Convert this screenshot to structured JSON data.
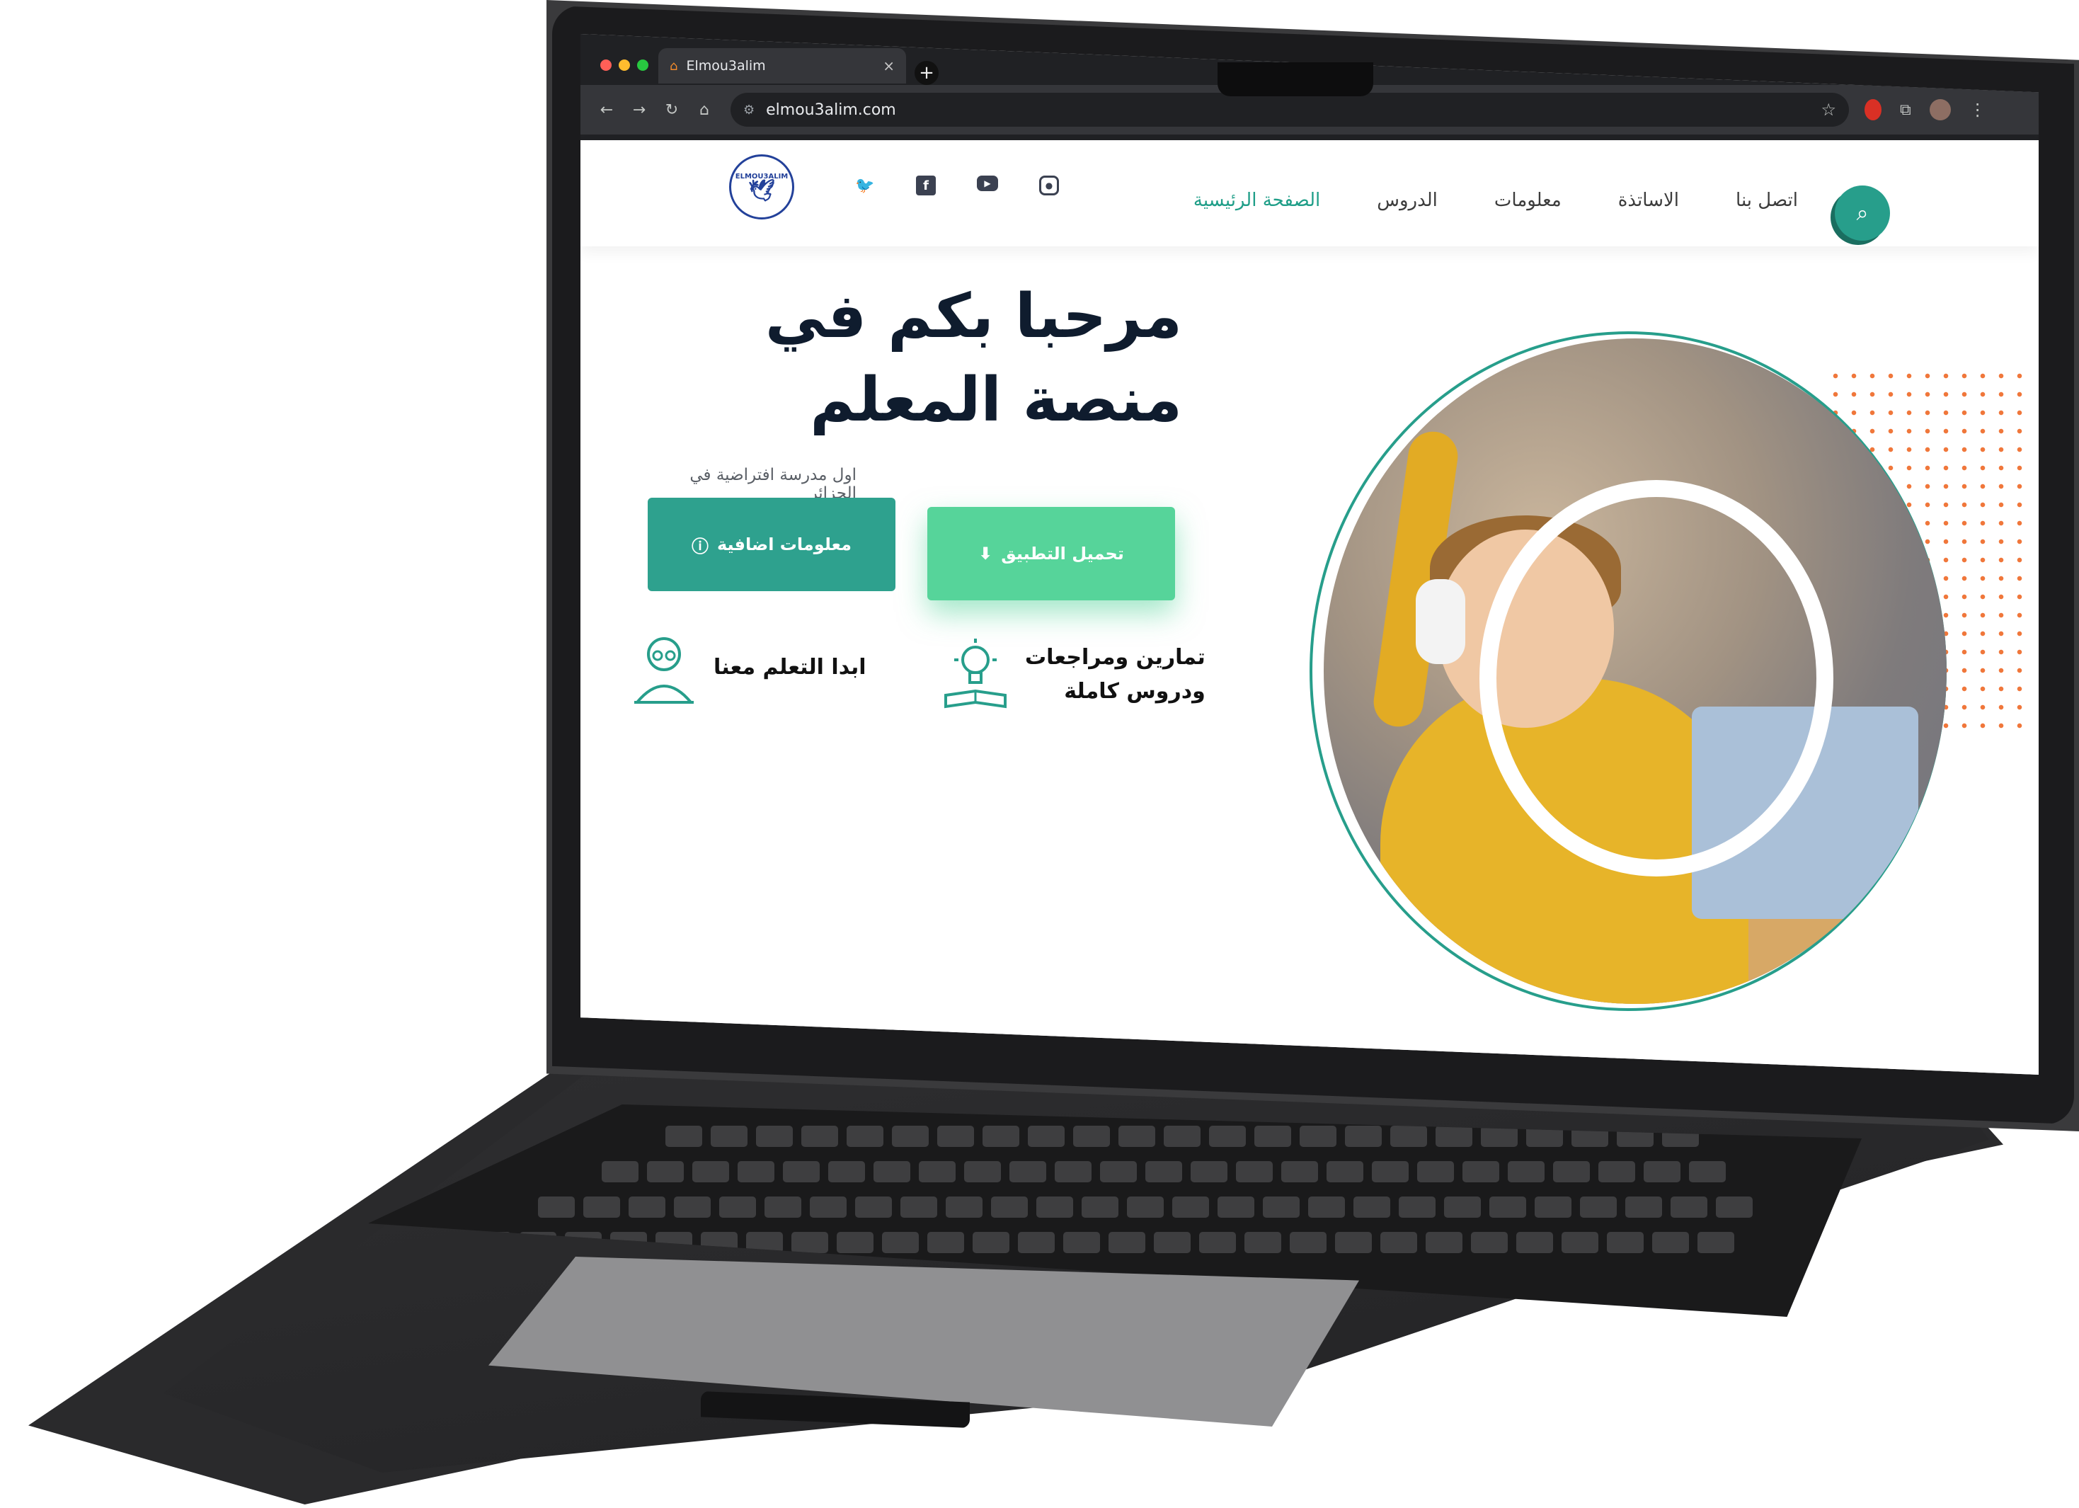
{
  "browser": {
    "tab_title": "Elmou3alim",
    "tab_close": "×",
    "new_tab": "+",
    "url": "elmou3alim.com",
    "nav": {
      "back": "←",
      "forward": "→",
      "reload": "↻",
      "home": "⌂"
    }
  },
  "site": {
    "logo_text": "ELMOU3ALIM",
    "socials": [
      "twitter",
      "facebook",
      "youtube",
      "instagram"
    ],
    "menu": {
      "home": "الصفحة الرئيسية",
      "lessons": "الدروس",
      "info": "معلومات",
      "teachers": "الاساتذة",
      "contact": "اتصل بنا"
    },
    "search_icon": "search-icon"
  },
  "hero": {
    "title": "مرحبا بكم في منصة المعلم",
    "subtitle": "اول مدرسة افتراضية في الجزائر",
    "btn_info": "معلومات اضافية",
    "btn_download": "تحميل التطبيق"
  },
  "features": {
    "start_learning": "ابدا التعلم معنا",
    "exercises_line1": "تمارين ومراجعات",
    "exercises_line2": "ودروس كاملة"
  },
  "colors": {
    "primary": "#279e8b",
    "accent_green": "#56d49a",
    "dots": "#f0773b",
    "dark_text": "#0f1c2e"
  }
}
